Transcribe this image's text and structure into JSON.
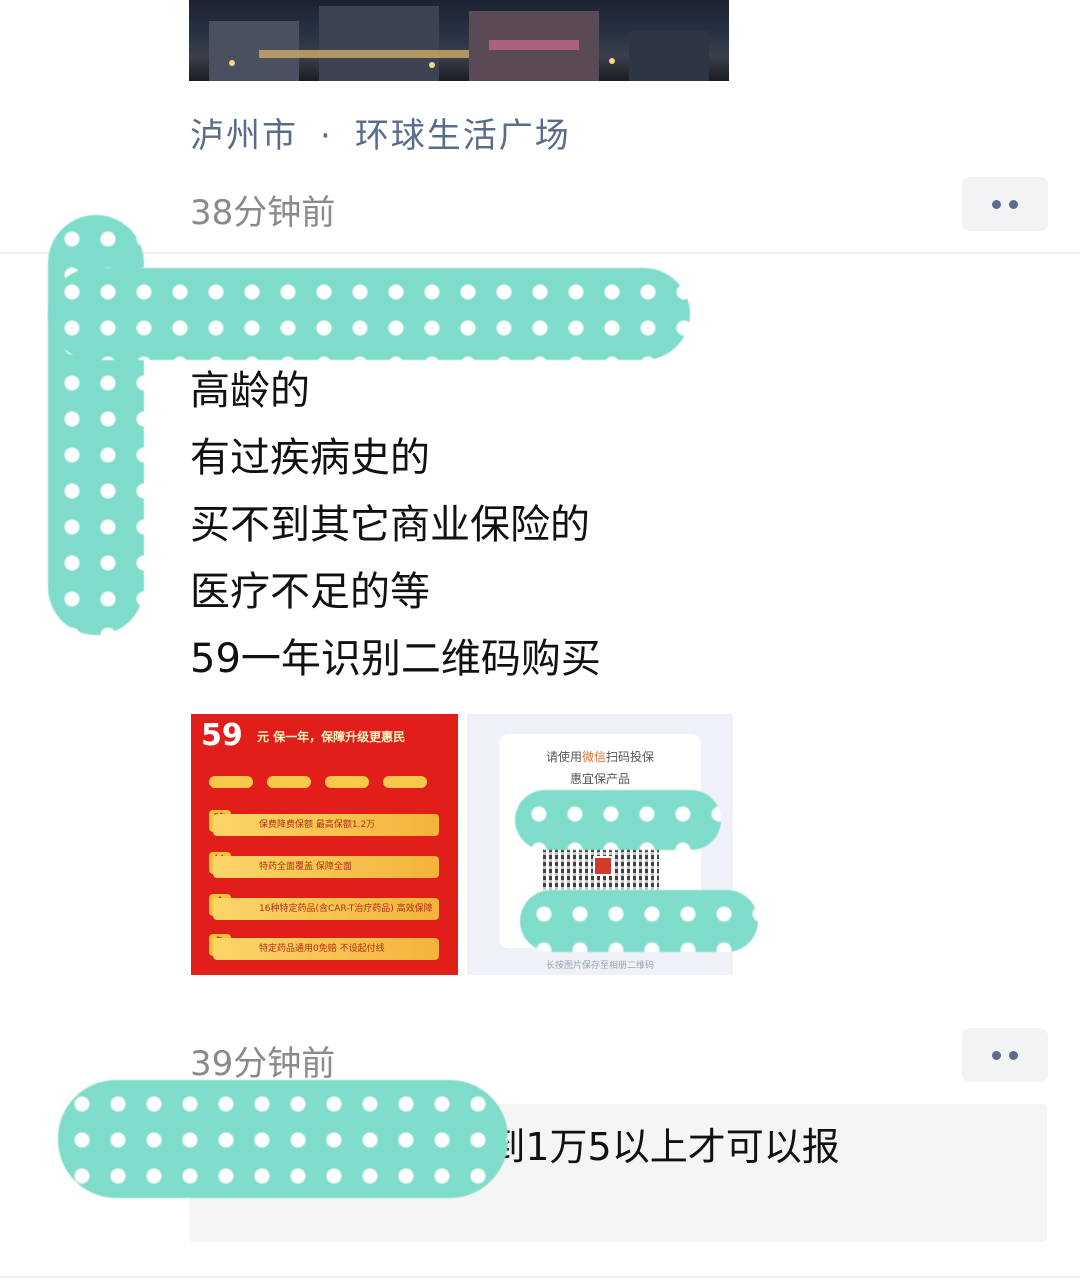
{
  "post1": {
    "location_city": "泸州市",
    "location_separator": "·",
    "location_place": "环球生活广场",
    "time": "38分钟前"
  },
  "post2": {
    "lines": [
      "高龄的",
      "有过疾病史的",
      "买不到其它商业保险的",
      "医疗不足的等",
      "59一年识别二维码购买"
    ],
    "poster": {
      "price": "59",
      "headline": "元 保一年，保障升级更惠民",
      "rows": [
        {
          "badge": "降",
          "text": "保费降费保额 最高保额1.2万"
        },
        {
          "badge": "扩",
          "text": "特药全面覆盖 保障全面"
        },
        {
          "badge": "全",
          "text": "16种特定药品(含CAR-T治疗药品) 高效保障"
        },
        {
          "badge": "免",
          "text": "特定药品通用0免赔 不设起付线"
        }
      ]
    },
    "qr_card": {
      "line1_prefix": "请使用",
      "line1_highlight": "微信",
      "line1_suffix": "扫码投保",
      "line2": "惠宜保产品",
      "footer": "长按图片保存至相册二维码"
    },
    "time": "39分钟前"
  },
  "comment": {
    "text": "上保报完减1万3到1万5以上才可以报"
  },
  "colors": {
    "link_blue": "#5b6b8c",
    "redaction_teal": "#7fdccb",
    "poster_red": "#e21e1a"
  }
}
